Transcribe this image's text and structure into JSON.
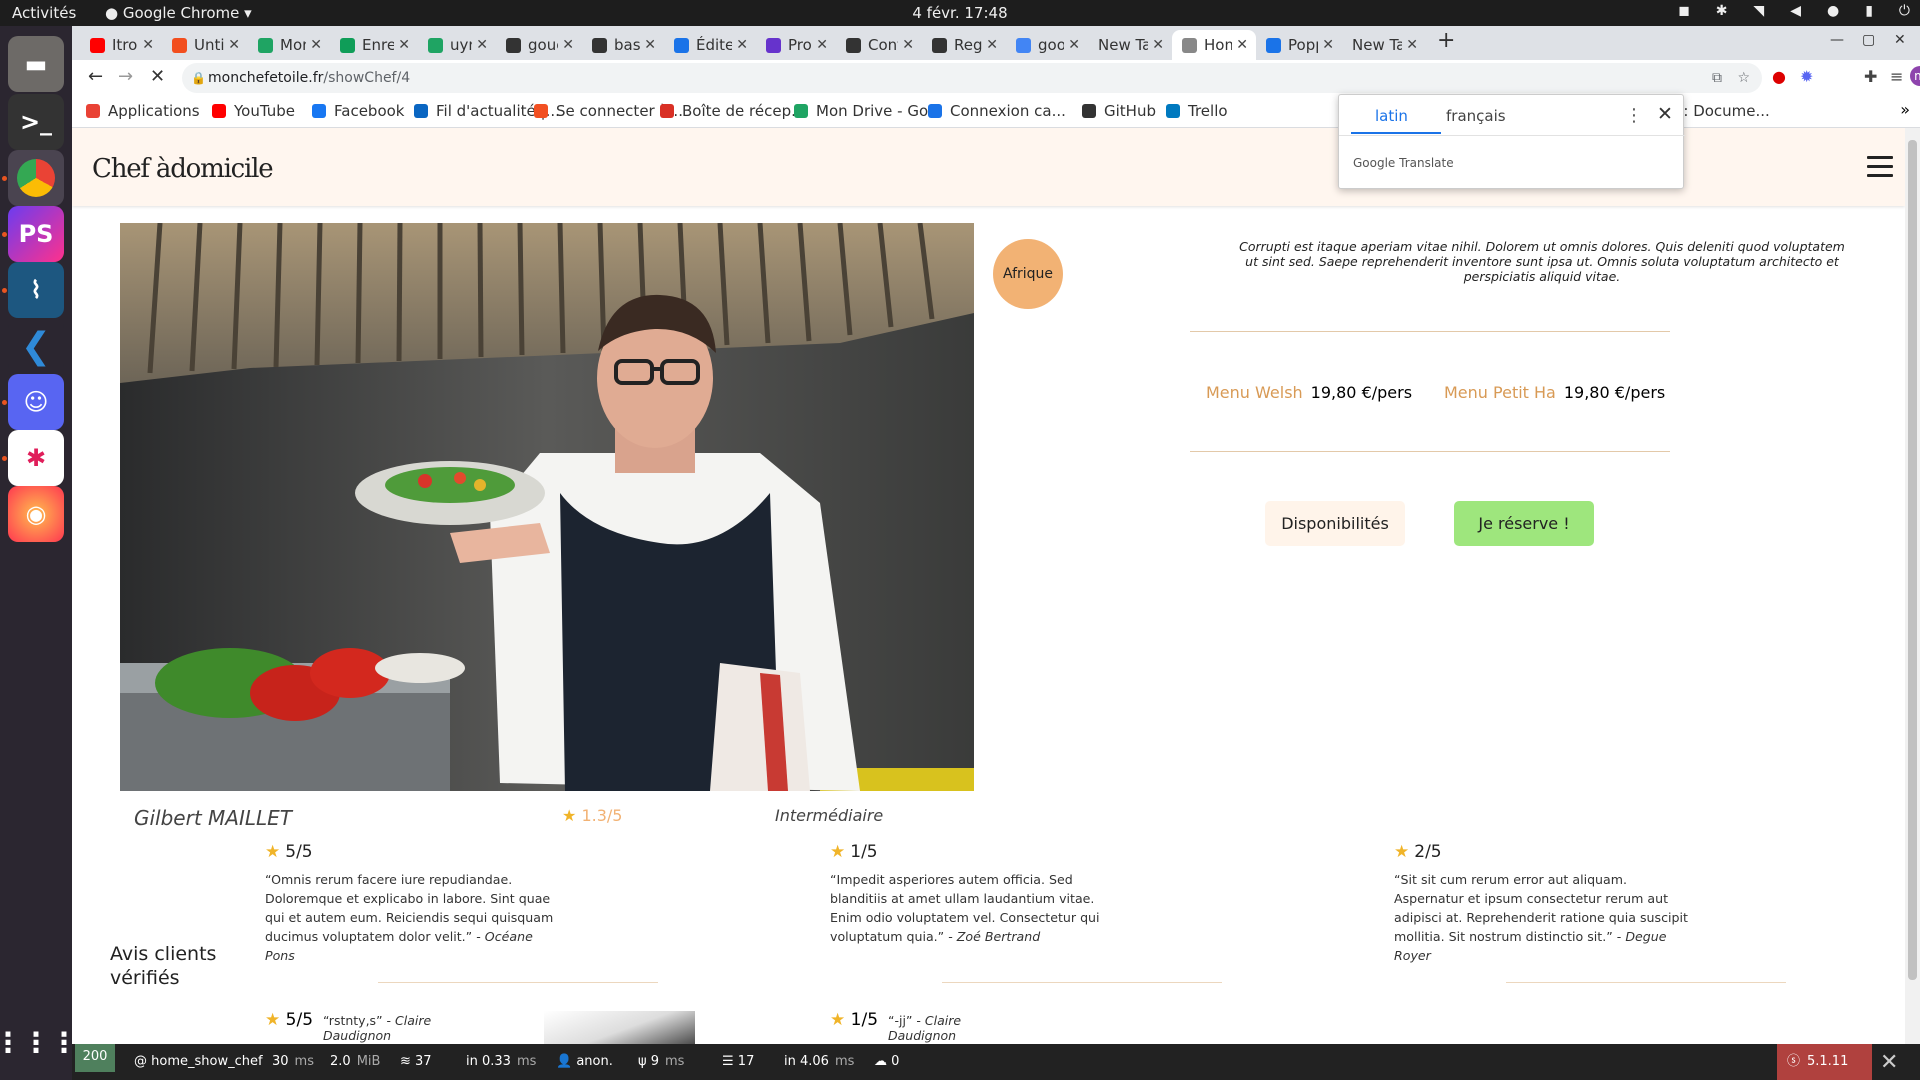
{
  "system": {
    "activities": "Activités",
    "app_name": "Google Chrome",
    "clock": "4 févr.  17:48"
  },
  "tabs": [
    {
      "label": "Itro &",
      "color": "#ff0000"
    },
    {
      "label": "Untitl",
      "color": "#f24e1e"
    },
    {
      "label": "Mon D",
      "color": "#1fa463"
    },
    {
      "label": "Enreg",
      "color": "#0f9d58"
    },
    {
      "label": "uyn-ai",
      "color": "#1fa463"
    },
    {
      "label": "gouet",
      "color": "#333333"
    },
    {
      "label": "basic",
      "color": "#333333"
    },
    {
      "label": "Éditer",
      "color": "#1a73e8"
    },
    {
      "label": "Progr",
      "color": "#6633cc"
    },
    {
      "label": "Conta",
      "color": "#333333"
    },
    {
      "label": "Regis",
      "color": "#333333"
    },
    {
      "label": "googl",
      "color": "#4285f4"
    },
    {
      "label": "New Tab",
      "color": ""
    },
    {
      "label": "Home",
      "color": "#888888"
    },
    {
      "label": "Poppi",
      "color": "#1a73e8"
    },
    {
      "label": "New Tab",
      "color": ""
    }
  ],
  "address": {
    "domain": "monchefetoile.fr",
    "path": "/showChef/4"
  },
  "bookmarks": [
    {
      "label": "Applications",
      "color": "#e94235"
    },
    {
      "label": "YouTube",
      "color": "#ff0000"
    },
    {
      "label": "Facebook",
      "color": "#1877f2"
    },
    {
      "label": "Fil d'actualité |...",
      "color": "#0a66c2"
    },
    {
      "label": "Se connecter à...",
      "color": "#f25022"
    },
    {
      "label": "Boîte de récep...",
      "color": "#d93025"
    },
    {
      "label": "Mon Drive - Go...",
      "color": "#1fa463"
    },
    {
      "label": "Connexion ca...",
      "color": "#1a73e8"
    },
    {
      "label": "GitHub",
      "color": "#333333"
    },
    {
      "label": "Trello",
      "color": "#0079bf"
    },
    {
      "label": "PHP: Docume...",
      "color": "#777bb3"
    }
  ],
  "site": {
    "brand": "Chef àdomicile"
  },
  "chef": {
    "cuisine_badge": "Afrique",
    "description": "Corrupti est itaque aperiam vitae nihil. Dolorem ut omnis dolores. Quis deleniti quod voluptatem ut sint sed. Saepe reprehenderit inventore sunt ipsa ut. Omnis soluta voluptatum architecto et perspiciatis aliquid vitae.",
    "name": "Gilbert MAILLET",
    "rating": "1.3/5",
    "level": "Intermédiaire",
    "menus": [
      {
        "name": "Menu Welsh",
        "price": "19,80 €/pers"
      },
      {
        "name": "Menu Petit Ha",
        "price": "19,80 €/pers"
      }
    ],
    "availability_button": "Disponibilités",
    "book_button": "Je réserve !"
  },
  "reviews_title": "Avis clients vérifiés",
  "reviews": [
    {
      "score": "5/5",
      "text": "“Omnis rerum facere iure repudiandae. Doloremque et explicabo in labore. Sint quae qui et autem eum. Reiciendis sequi quisquam ducimus voluptatem dolor velit.”",
      "author": "Océane Pons"
    },
    {
      "score": "1/5",
      "text": "“Impedit asperiores autem officia. Sed blanditiis at amet ullam laudantium vitae. Enim odio voluptatem vel. Consectetur qui voluptatum quia.”",
      "author": "Zoé Bertrand"
    },
    {
      "score": "2/5",
      "text": "“Sit sit cum rerum error aut aliquam. Aspernatur et ipsum consectetur rerum aut adipisci at. Reprehenderit ratione quia suscipit mollitia. Sit nostrum distinctio sit.”",
      "author": "Degue Royer"
    }
  ],
  "reviews_row2": [
    {
      "score": "5/5",
      "text": "“rstnty,s”",
      "author": "Claire Daudignon"
    },
    {
      "score": "1/5",
      "text": "“-jj”",
      "author": "Claire Daudignon"
    }
  ],
  "translate_popup": {
    "source_lang": "latin",
    "target_lang": "français",
    "brand": "Google Translate"
  },
  "debug_toolbar": {
    "status": "200",
    "route": "@ home_show_chef",
    "time": "30",
    "time_unit": "ms",
    "memory": "2.0",
    "memory_unit": "MiB",
    "forms": "37",
    "ajax": "in 0.33",
    "ajax_unit": "ms",
    "user": "anon.",
    "twig": "9",
    "twig_unit": "ms",
    "db": "17",
    "db_time": "in 4.06",
    "db_unit": "ms",
    "cache": "0",
    "version": "5.1.11"
  }
}
